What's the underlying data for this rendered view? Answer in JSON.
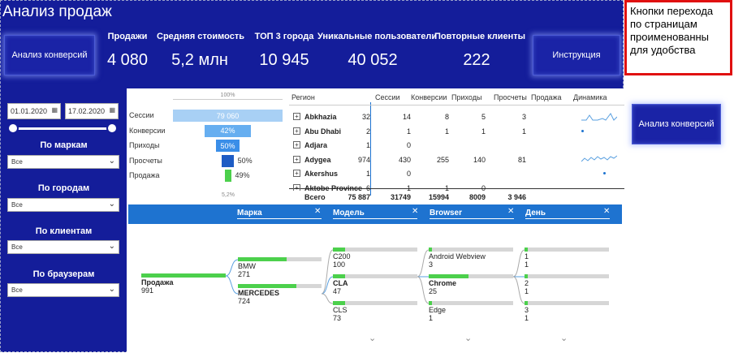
{
  "title": "Анализ продаж",
  "nav": {
    "conversions": "Анализ конверсий",
    "instructions": "Инструкция",
    "side_conversions": "Анализ конверсий"
  },
  "kpis": [
    {
      "label": "Продажи",
      "value": "4 080"
    },
    {
      "label": "Средняя стоимость",
      "value": "5,2 млн"
    },
    {
      "label": "ТОП 3 города",
      "value": "10 945"
    },
    {
      "label": "Уникальные пользователи",
      "value": "40 052"
    },
    {
      "label": "Повторные клиенты",
      "value": "222"
    }
  ],
  "filters": {
    "date_from": "01.01.2020",
    "date_to": "17.02.2020",
    "brand_label": "По маркам",
    "city_label": "По городам",
    "client_label": "По клиентам",
    "browser_label": "По браузерам",
    "all": "Все"
  },
  "funnel": {
    "top": "100%",
    "bottom": "5,2%",
    "stages": [
      {
        "label": "Сессии",
        "value": "79 060",
        "fill": 100
      },
      {
        "label": "Конверсии",
        "value": "42%",
        "fill": 42
      },
      {
        "label": "Приходы",
        "value": "50%",
        "fill": 21
      },
      {
        "label": "Просчеты",
        "value": "50%",
        "fill": 10.5
      },
      {
        "label": "Продажа",
        "value": "49%",
        "fill": 5.2
      }
    ]
  },
  "grid": {
    "headers": [
      "Регион",
      "Сессии",
      "Конверсии",
      "Приходы",
      "Просчеты",
      "Продажа",
      "Динамика"
    ],
    "rows": [
      {
        "name": "Abkhazia",
        "v": [
          "32",
          "14",
          "8",
          "5",
          "3"
        ]
      },
      {
        "name": "Abu Dhabi",
        "v": [
          "2",
          "1",
          "1",
          "1",
          "1"
        ]
      },
      {
        "name": "Adjara",
        "v": [
          "1",
          "0",
          "",
          "",
          ""
        ]
      },
      {
        "name": "Adygea",
        "v": [
          "974",
          "430",
          "255",
          "140",
          "81"
        ]
      },
      {
        "name": "Akershus",
        "v": [
          "1",
          "0",
          "",
          "",
          ""
        ]
      },
      {
        "name": "Aktobe Province",
        "v": [
          "6",
          "1",
          "1",
          "0",
          ""
        ]
      }
    ],
    "total": {
      "name": "Всего",
      "v": [
        "75 887",
        "31749",
        "15994",
        "8009",
        "3 946"
      ]
    }
  },
  "tree": {
    "levels": [
      "Марка",
      "Модель",
      "Browser",
      "День"
    ],
    "root": {
      "name": "Продажа",
      "value": "991"
    },
    "brands": [
      {
        "name": "BMW",
        "value": "271"
      },
      {
        "name": "MERCEDES",
        "value": "724"
      }
    ],
    "models": [
      {
        "name": "C200",
        "value": "100"
      },
      {
        "name": "CLA",
        "value": "47"
      },
      {
        "name": "CLS",
        "value": "73"
      }
    ],
    "browsers": [
      {
        "name": "Android Webview",
        "value": "3"
      },
      {
        "name": "Chrome",
        "value": "25"
      },
      {
        "name": "Edge",
        "value": "1"
      }
    ],
    "days": [
      {
        "name": "1",
        "value": "1"
      },
      {
        "name": "2",
        "value": "1"
      },
      {
        "name": "3",
        "value": "1"
      }
    ]
  },
  "note": "Кнопки перехода по страницам проименованны для удобства"
}
